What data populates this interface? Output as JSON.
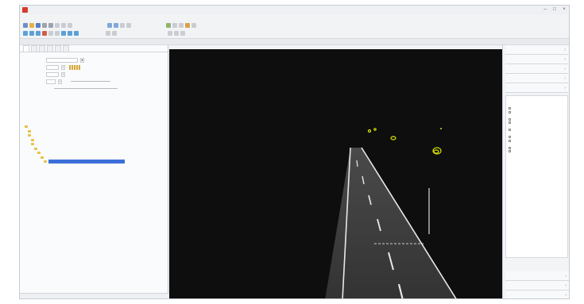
{
  "window": {
    "title": ""
  },
  "menu": [
    "",
    "",
    "",
    "",
    "",
    "",
    "",
    "",
    "",
    "",
    "",
    ""
  ],
  "left_panel": {
    "tabs": [
      "",
      "",
      "",
      "",
      "",
      ""
    ],
    "bottom_tabs": [
      "",
      "",
      "",
      "",
      ""
    ]
  },
  "right_panel": {
    "buttons": [
      "",
      "",
      "",
      "",
      ""
    ],
    "bottom_buttons": [
      "",
      "",
      ""
    ]
  },
  "colors": {
    "viewport_bg": "#0e0e0e",
    "road": "#3a3a3a",
    "lane_marking": "#e8e8e8",
    "highlight_yellow": "#d7e000",
    "selection": "#3b6fd8"
  },
  "icons": {
    "app": "app-logo-icon",
    "minimize": "minimize-icon",
    "maximize": "maximize-icon",
    "close": "close-icon"
  }
}
